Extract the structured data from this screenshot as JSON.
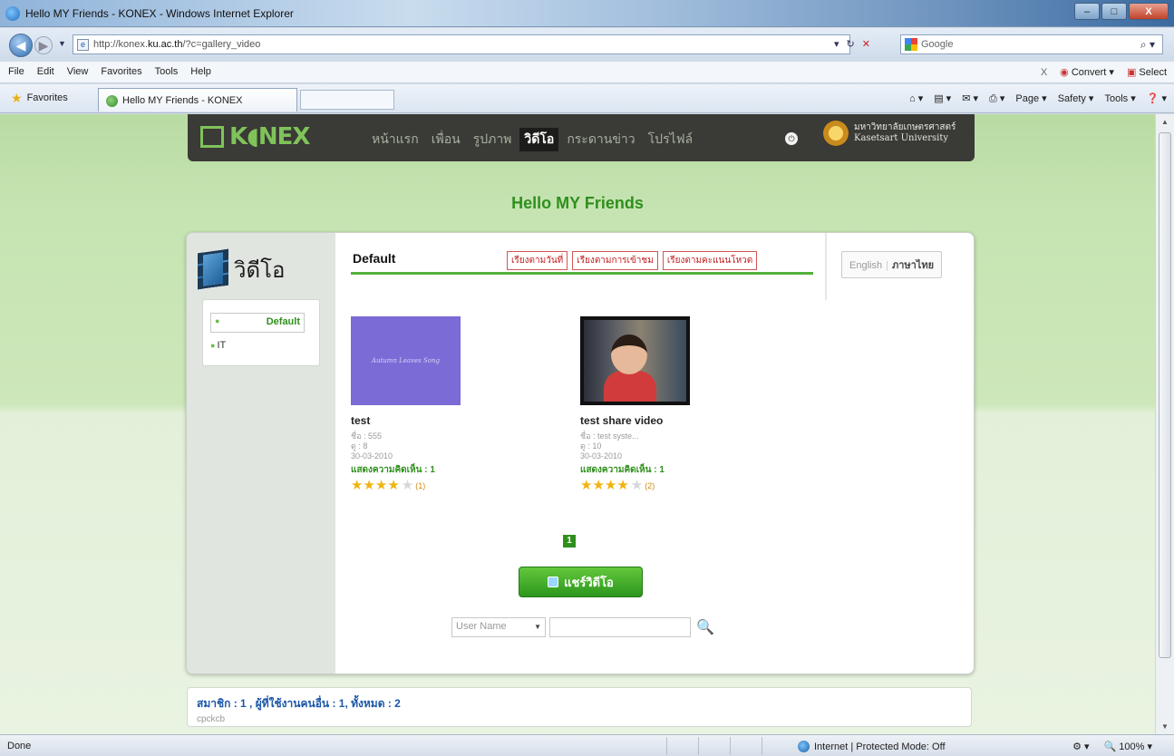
{
  "window": {
    "title": "Hello MY Friends - KONEX - Windows Internet Explorer",
    "minimize": "–",
    "maximize": "□",
    "close": "X"
  },
  "address": {
    "url_prefix": "http://konex.",
    "url_host": "ku.ac.th",
    "url_suffix": "/?c=gallery_video",
    "search_placeholder": "Google"
  },
  "menu": {
    "items": [
      "File",
      "Edit",
      "View",
      "Favorites",
      "Tools",
      "Help"
    ],
    "close_x": "X",
    "convert": "Convert",
    "select": "Select"
  },
  "favorites": {
    "label": "Favorites",
    "tab_title": "Hello MY Friends - KONEX",
    "commands": [
      "Page",
      "Safety",
      "Tools"
    ]
  },
  "site": {
    "logo": "K◖NEX",
    "nav": [
      "หน้าแรก",
      "เพื่อน",
      "รูปภาพ",
      "วิดีโอ",
      "กระดานข่าว",
      "โปรไฟล์"
    ],
    "nav_active_index": 3,
    "university_th": "มหาวิทยาลัยเกษตรศาสตร์",
    "university_en": "Kasetsart University",
    "headline": "Hello MY Friends"
  },
  "gallery": {
    "section_title": "วิดีโอ",
    "categories": [
      {
        "label": "Default",
        "selected": true
      },
      {
        "label": "IT",
        "selected": false
      }
    ],
    "current_category": "Default",
    "sort_options": [
      "เรียงตามวันที่",
      "เรียงตามการเข้าชม",
      "เรียงตามคะแนนโหวต"
    ],
    "lang_en": "English",
    "lang_sep": "|",
    "lang_th": "ภาษาไทย",
    "videos": [
      {
        "title": "test",
        "thumb_text": "Autumn Leaves Song",
        "name_line": "ชื่อ : 555",
        "views_line": "ดู : 8",
        "date": "30-03-2010",
        "comments": "แสดงความคิดเห็น : 1",
        "rating": 4,
        "votes": "(1)"
      },
      {
        "title": "test share video",
        "thumb_text": "",
        "name_line": "ชื่อ : test syste...",
        "views_line": "ดู : 10",
        "date": "30-03-2010",
        "comments": "แสดงความคิดเห็น : 1",
        "rating": 4,
        "votes": "(2)"
      }
    ],
    "page": "1",
    "share_button": "แชร์วิดีโอ",
    "search_select": "User Name"
  },
  "online": {
    "summary": "สมาชิก : 1 , ผู้ที่ใช้งานคนอื่น : 1, ทั้งหมด : 2",
    "users": "cpckcb"
  },
  "statusbar": {
    "left": "Done",
    "zone": "Internet | Protected Mode: Off",
    "zoom": "100%"
  }
}
